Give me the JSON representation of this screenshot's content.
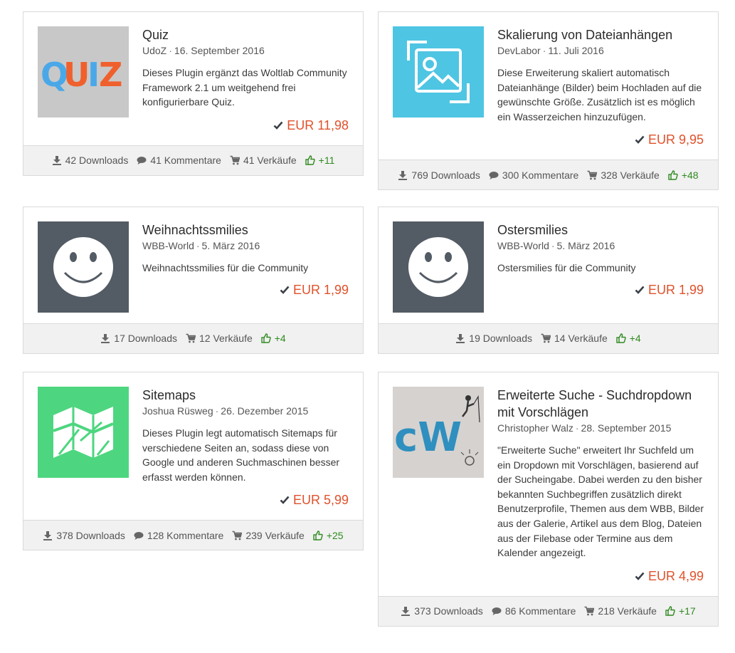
{
  "cards": [
    {
      "title": "Quiz",
      "author": "UdoZ",
      "date": "16. September 2016",
      "description": "Dieses Plugin ergänzt das Woltlab Community Framework 2.1 um weitgehend frei konfigurierbare Quiz.",
      "price": "EUR 11,98",
      "downloads": "42 Downloads",
      "comments": "41 Kommentare",
      "sales": "41 Verkäufe",
      "likes": "+11",
      "image": "quiz-logo",
      "image_text": [
        "Q",
        "U",
        "I",
        "Z"
      ]
    },
    {
      "title": "Skalierung von Dateianhängen",
      "author": "DevLabor",
      "date": "11. Juli 2016",
      "description": "Diese Erweiterung skaliert automatisch Dateianhänge (Bilder) beim Hochladen auf die gewünschte Größe. Zusätzlich ist es möglich ein Wasserzeichen hinzuzufügen.",
      "price": "EUR 9,95",
      "downloads": "769 Downloads",
      "comments": "300 Kommentare",
      "sales": "328 Verkäufe",
      "likes": "+48",
      "image": "image-scale-icon"
    },
    {
      "title": "Weihnachtssmilies",
      "author": "WBB-World",
      "date": "5. März 2016",
      "description": "Weihnachtssmilies für die Community",
      "price": "EUR 1,99",
      "downloads": "17 Downloads",
      "sales": "12 Verkäufe",
      "likes": "+4",
      "image": "smiley-icon"
    },
    {
      "title": "Ostersmilies",
      "author": "WBB-World",
      "date": "5. März 2016",
      "description": "Ostersmilies für die Community",
      "price": "EUR 1,99",
      "downloads": "19 Downloads",
      "sales": "14 Verkäufe",
      "likes": "+4",
      "image": "smiley-icon"
    },
    {
      "title": "Sitemaps",
      "author": "Joshua Rüsweg",
      "date": "26. Dezember 2015",
      "description": "Dieses Plugin legt automatisch Sitemaps für verschiedene Seiten an, sodass diese von Google und anderen Suchmaschinen besser erfasst werden können.",
      "price": "EUR 5,99",
      "downloads": "378 Downloads",
      "comments": "128 Kommentare",
      "sales": "239 Verkäufe",
      "likes": "+25",
      "image": "map-icon"
    },
    {
      "title": "Erweiterte Suche - Suchdropdown mit Vorschlägen",
      "author": "Christopher Walz",
      "date": "28. September 2015",
      "description": "\"Erweiterte Suche\" erweitert Ihr Suchfeld um ein Dropdown mit Vorschlägen, basierend auf der Sucheingabe. Dabei werden zu den bisher bekannten Suchbegriffen zusätzlich direkt Benutzerprofile, Themen aus dem WBB, Bilder aus der Galerie, Artikel aus dem Blog, Dateien aus der Filebase oder Termine aus dem Kalender angezeigt.",
      "price": "EUR 4,99",
      "downloads": "373 Downloads",
      "comments": "86 Kommentare",
      "sales": "218 Verkäufe",
      "likes": "+17",
      "image": "cw-logo",
      "image_text": "cW"
    }
  ],
  "colors": {
    "price": "#e0512b",
    "likes": "#2f8a1f",
    "check": "#3a3f47"
  }
}
